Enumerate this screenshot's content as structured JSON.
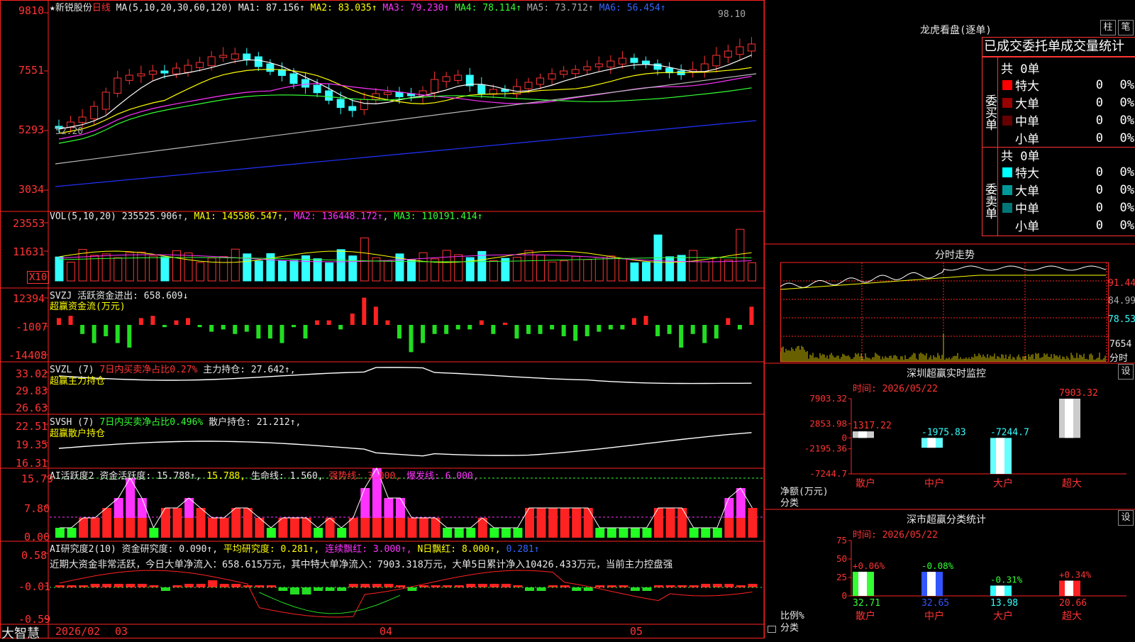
{
  "app_name": "大智慧",
  "stock": {
    "name": "★新锐股份",
    "period": "日线"
  },
  "main": {
    "ma_title": "MA(5,10,20,30,60,120)",
    "ma1": "MA1: 87.156↑",
    "ma2": "MA2: 83.035↑",
    "ma3": "MA3: 79.230↑",
    "ma4": "MA4: 78.114↑",
    "ma5": "MA5: 73.712↑",
    "ma6": "MA6: 56.454↑",
    "y_ticks": [
      "9810",
      "7551",
      "5293",
      "3034"
    ],
    "high_label": "98.10",
    "low_label": "52.20",
    "colors": {
      "ma1": "#ffffff",
      "ma2": "#ffff00",
      "ma3": "#ff33ff",
      "ma4": "#33ff33",
      "ma5": "#cccccc",
      "ma6": "#2233ff",
      "up": "#ff3333",
      "down": "#33ffff"
    }
  },
  "vol": {
    "title": "VOL(5,10,20)",
    "value": "235525.906↑",
    "ma1": "MA1: 145586.547↑",
    "ma2": "MA2: 136448.172↑",
    "ma3": "MA3: 110191.414↑",
    "y_ticks": [
      "23553",
      "11631"
    ],
    "unit": "X10"
  },
  "svzj": {
    "title": "SVZJ",
    "label": "活跃资金进出: 658.609↓",
    "subtitle": "超赢资金流(万元)",
    "y_ticks": [
      "12394",
      "-1007",
      "-14408"
    ]
  },
  "svzl": {
    "title": "SVZL (7)",
    "pct": "7日内买卖净占比0.27%",
    "label": "主力持仓: 27.642↑,",
    "subtitle": "超赢主力持仓",
    "y_ticks": [
      "33.02",
      "29.83",
      "26.63"
    ]
  },
  "svsh": {
    "title": "SVSH (7)",
    "pct": "7日内买卖净占比0.496%",
    "label": "散户持仓: 21.212↑,",
    "subtitle": "超赢散户持仓",
    "y_ticks": [
      "22.51",
      "19.35",
      "16.31"
    ]
  },
  "huoyue": {
    "title": "AI活跃度2",
    "a": "资金活跃度: 15.788↑,",
    "b": "15.788,",
    "c": "生命线: 1.560,",
    "d": "强势线: 3.000,",
    "e": "爆发线: 6.000,",
    "y_ticks": [
      "15.79",
      "7.80",
      "0.00"
    ]
  },
  "yanjiu": {
    "title": "AI研究度2(10)",
    "a": "资金研究度: 0.090↑,",
    "b": "平均研究度: 0.281↑,",
    "c": "连续飘红: 3.000↑,",
    "d": "N日飘红: 8.000↑,",
    "e": "0.281↑",
    "comment": "近期大资金非常活跃，今日大单净流入：658.615万元，其中特大单净流入：7903.318万元，大单5日累计净入10426.433万元，当前主力控盘强",
    "y_ticks": [
      "0.58",
      "-0.01",
      "-0.59"
    ]
  },
  "xaxis": {
    "labels": [
      "2026/02",
      "03",
      "04",
      "05"
    ]
  },
  "lhk": {
    "title": "龙虎看盘(逐单)",
    "btn1": "柱",
    "btn2": "笔",
    "tabs": "已成交委托单成交量统计",
    "buy": {
      "label": "委买单",
      "total": "共 0单",
      "rows": [
        {
          "name": "特大",
          "v": "0",
          "p": "0%",
          "c": "#ff0000"
        },
        {
          "name": "大单",
          "v": "0",
          "p": "0%",
          "c": "#990000"
        },
        {
          "name": "中单",
          "v": "0",
          "p": "0%",
          "c": "#660000"
        },
        {
          "name": "小单",
          "v": "0",
          "p": "0%",
          "c": "#000000"
        }
      ]
    },
    "sell": {
      "label": "委卖单",
      "total": "共 0单",
      "rows": [
        {
          "name": "特大",
          "v": "0",
          "p": "0%",
          "c": "#00ffff"
        },
        {
          "name": "大单",
          "v": "0",
          "p": "0%",
          "c": "#009999"
        },
        {
          "name": "中单",
          "v": "0",
          "p": "0%",
          "c": "#007777"
        },
        {
          "name": "小单",
          "v": "0",
          "p": "0%",
          "c": "#000000"
        }
      ]
    }
  },
  "intraday": {
    "title": "分时走势",
    "y_ticks": [
      "91.44",
      "84.99",
      "78.53"
    ],
    "vol_tick": "7654",
    "unit": "分时"
  },
  "sz_monitor": {
    "title": "深圳超赢实时监控",
    "btn": "设",
    "time": "时间: 2026/05/22",
    "y_ticks": [
      "7903.32",
      "2853.98",
      "0",
      "-2195.36",
      "-7244.7"
    ],
    "ylabel": "净额(万元)",
    "xlabel": "分类",
    "bars": [
      {
        "cat": "散户",
        "value": 1317.22,
        "label": "1317.22"
      },
      {
        "cat": "中户",
        "value": -1975.83,
        "label": "-1975.83"
      },
      {
        "cat": "大户",
        "value": -7244.7,
        "label": "-7244.7"
      },
      {
        "cat": "超大",
        "value": 7903.32,
        "label": "7903.32"
      }
    ]
  },
  "sz_stats": {
    "title": "深市超赢分类统计",
    "btn": "设",
    "time": "时间: 2026/05/22",
    "y_ticks": [
      "75",
      "50",
      "25",
      "0"
    ],
    "ylabel": "比例%",
    "xlabel": "分类",
    "bars": [
      {
        "cat": "散户",
        "value": 32.71,
        "label": "32.71",
        "change": "+0.06%"
      },
      {
        "cat": "中户",
        "value": 32.65,
        "label": "32.65",
        "change": "-0.08%"
      },
      {
        "cat": "大户",
        "value": 13.98,
        "label": "13.98",
        "change": "-0.31%"
      },
      {
        "cat": "超大",
        "value": 20.66,
        "label": "20.66",
        "change": "+0.34%"
      }
    ]
  },
  "chart_data": [
    {
      "type": "bar",
      "title": "深圳超赢实时监控",
      "ylabel": "净额(万元)",
      "xlabel": "分类",
      "categories": [
        "散户",
        "中户",
        "大户",
        "超大"
      ],
      "values": [
        1317.22,
        -1975.83,
        -7244.7,
        7903.32
      ],
      "ylim": [
        -7244.7,
        7903.32
      ]
    },
    {
      "type": "bar",
      "title": "深市超赢分类统计",
      "ylabel": "比例%",
      "xlabel": "分类",
      "categories": [
        "散户",
        "中户",
        "大户",
        "超大"
      ],
      "values": [
        32.71,
        32.65,
        13.98,
        20.66
      ],
      "ylim": [
        0,
        75
      ]
    }
  ]
}
